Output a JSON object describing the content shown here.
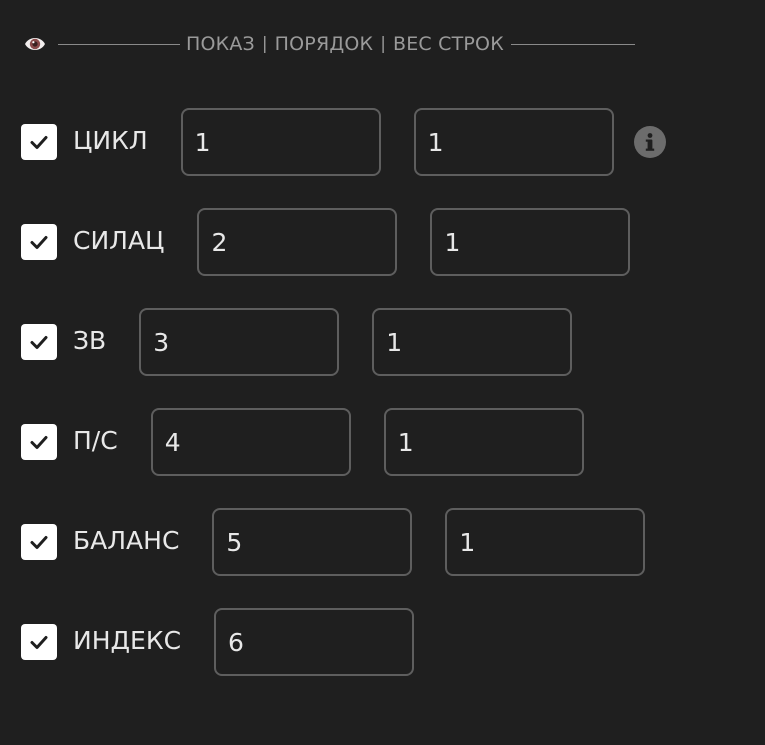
{
  "header": {
    "icon": "eye-icon",
    "segments": [
      "ПОКАЗ",
      "ПОРЯДОК",
      "ВЕС СТРОК"
    ],
    "separator": "|"
  },
  "rows": [
    {
      "label": "ЦИКЛ",
      "checked": true,
      "order": "1",
      "weight": "1",
      "has_info": true
    },
    {
      "label": "СИЛАЦ",
      "checked": true,
      "order": "2",
      "weight": "1"
    },
    {
      "label": "ЗВ",
      "checked": true,
      "order": "3",
      "weight": "1"
    },
    {
      "label": "П/С",
      "checked": true,
      "order": "4",
      "weight": "1"
    },
    {
      "label": "БАЛАНС",
      "checked": true,
      "order": "5",
      "weight": "1"
    },
    {
      "label": "ИНДЕКС",
      "checked": true,
      "order": "6"
    }
  ],
  "icons": {
    "checkbox_mark": "check-icon",
    "info": "info-icon"
  }
}
